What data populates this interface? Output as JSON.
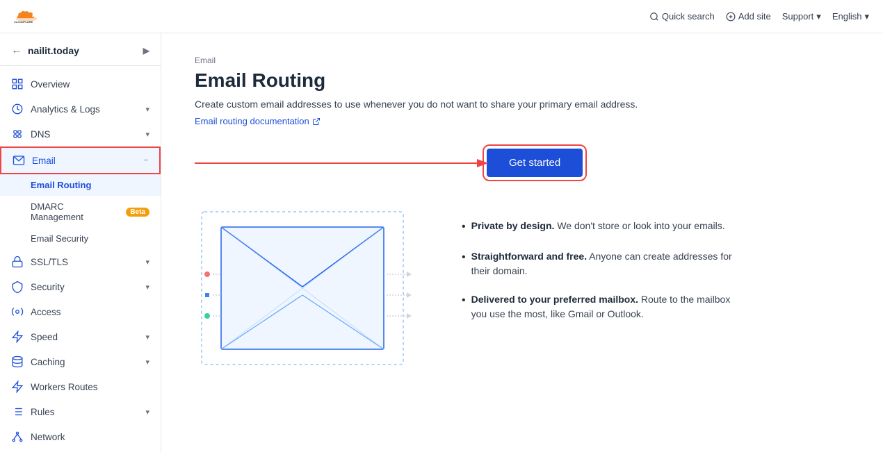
{
  "topnav": {
    "logo_alt": "Cloudflare",
    "quick_search": "Quick search",
    "add_site": "Add site",
    "support": "Support",
    "language": "English"
  },
  "sidebar": {
    "domain": "nailit.today",
    "items": [
      {
        "id": "overview",
        "label": "Overview",
        "icon": "grid",
        "has_children": false
      },
      {
        "id": "analytics",
        "label": "Analytics & Logs",
        "icon": "chart",
        "has_children": true
      },
      {
        "id": "dns",
        "label": "DNS",
        "icon": "dns",
        "has_children": true
      },
      {
        "id": "email",
        "label": "Email",
        "icon": "email",
        "has_children": true,
        "active": true,
        "children": [
          {
            "id": "email-routing",
            "label": "Email Routing",
            "active": true
          },
          {
            "id": "dmarc",
            "label": "DMARC Management",
            "badge": "Beta"
          },
          {
            "id": "email-security",
            "label": "Email Security"
          }
        ]
      },
      {
        "id": "ssl",
        "label": "SSL/TLS",
        "icon": "lock",
        "has_children": true
      },
      {
        "id": "security",
        "label": "Security",
        "icon": "shield",
        "has_children": true
      },
      {
        "id": "access",
        "label": "Access",
        "icon": "access",
        "has_children": false
      },
      {
        "id": "speed",
        "label": "Speed",
        "icon": "speed",
        "has_children": true
      },
      {
        "id": "caching",
        "label": "Caching",
        "icon": "caching",
        "has_children": true
      },
      {
        "id": "workers-routes",
        "label": "Workers Routes",
        "icon": "workers",
        "has_children": false
      },
      {
        "id": "rules",
        "label": "Rules",
        "icon": "rules",
        "has_children": true
      },
      {
        "id": "network",
        "label": "Network",
        "icon": "network",
        "has_children": false
      }
    ]
  },
  "main": {
    "breadcrumb": "Email",
    "title": "Email Routing",
    "description": "Create custom email addresses to use whenever you do not want to share your primary email address.",
    "doc_link": "Email routing documentation",
    "get_started_label": "Get started",
    "features": [
      {
        "bold": "Private by design.",
        "text": " We don't store or look into your emails."
      },
      {
        "bold": "Straightforward and free.",
        "text": " Anyone can create addresses for their domain."
      },
      {
        "bold": "Delivered to your preferred mailbox.",
        "text": " Route to the mailbox you use the most, like Gmail or Outlook."
      }
    ]
  }
}
